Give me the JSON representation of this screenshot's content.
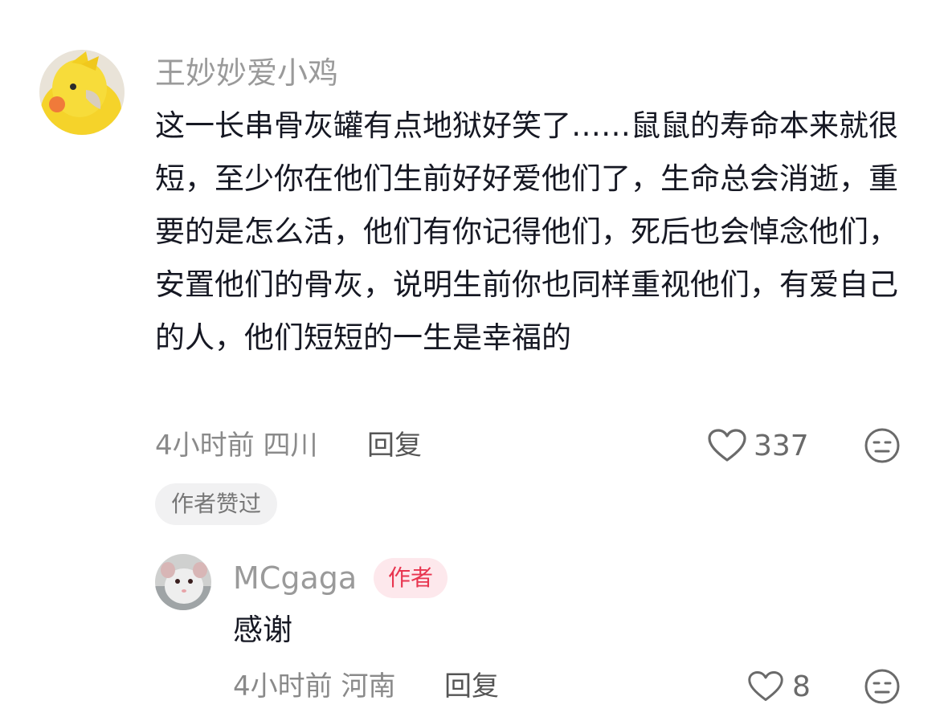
{
  "comment": {
    "username": "王妙妙爱小鸡",
    "text": "这一长串骨灰罐有点地狱好笑了……鼠鼠的寿命本来就很短，至少你在他们生前好好爱他们了，生命总会消逝，重要的是怎么活，他们有你记得他们，死后也会悼念他们，安置他们的骨灰，说明生前你也同样重视他们，有爱自己的人，他们短短的一生是幸福的",
    "time": "4小时前",
    "location": "四川",
    "reply_label": "回复",
    "like_count": "337",
    "author_liked_label": "作者赞过",
    "avatar_icon": "cockatiel-avatar"
  },
  "reply": {
    "username": "MCgaga",
    "author_badge": "作者",
    "text": "感谢",
    "time": "4小时前",
    "location": "河南",
    "reply_label": "回复",
    "like_count": "8",
    "avatar_icon": "rat-avatar"
  },
  "colors": {
    "author_badge_text": "#e8354f",
    "author_badge_bg": "#fde8ec",
    "username": "#9a9a9a",
    "text": "#161823"
  }
}
